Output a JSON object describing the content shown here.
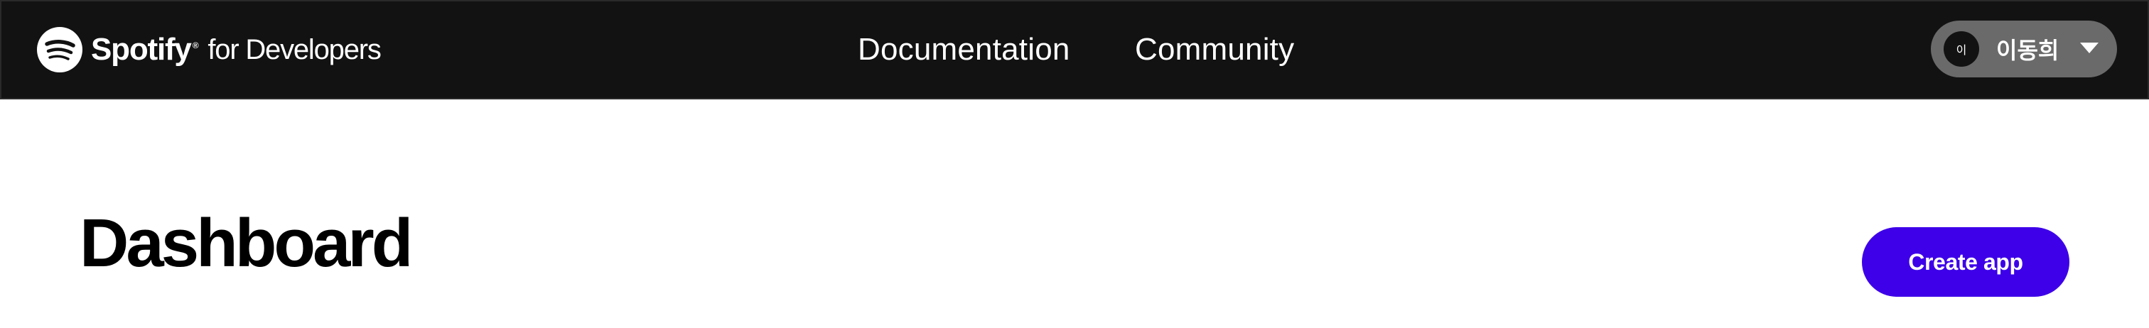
{
  "header": {
    "brand": {
      "wordmark": "Spotify",
      "trademark": "®",
      "sub": "for Developers",
      "icon": "spotify-logo-icon"
    },
    "nav": [
      {
        "label": "Documentation"
      },
      {
        "label": "Community"
      }
    ],
    "user": {
      "avatar_initial": "이",
      "name": "이동희",
      "menu_icon": "chevron-down-icon"
    }
  },
  "main": {
    "title": "Dashboard",
    "create_app_label": "Create app"
  },
  "colors": {
    "topbar_bg": "#121212",
    "user_pill_bg": "#6a6a6a",
    "primary_button": "#3d00e8",
    "text_dark": "#000000",
    "text_light": "#ffffff"
  }
}
